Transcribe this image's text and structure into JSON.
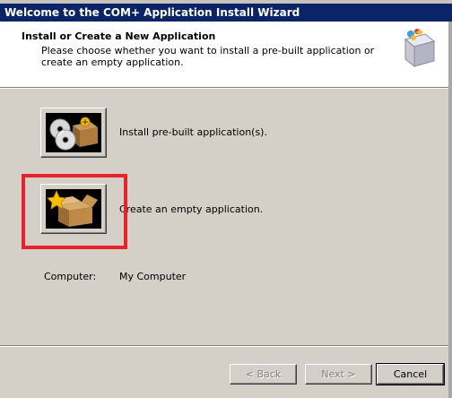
{
  "window": {
    "title": "Welcome to the COM+ Application Install Wizard"
  },
  "header": {
    "title": "Install or Create a New Application",
    "description": "Please choose whether you want to install a pre-built application or create an empty application.",
    "icon": "wizard-box-icon"
  },
  "options": [
    {
      "label": "Install pre-built application(s).",
      "icon": "cd-discs-box-icon"
    },
    {
      "label": "Create an empty application.",
      "icon": "open-box-star-icon"
    }
  ],
  "computer": {
    "label": "Computer:",
    "value": "My Computer"
  },
  "buttons": {
    "back": "< Back",
    "next": "Next >",
    "cancel": "Cancel"
  },
  "colors": {
    "titlebar": "#0a246a",
    "highlight": "#e8212a",
    "face": "#d4d0c8"
  }
}
